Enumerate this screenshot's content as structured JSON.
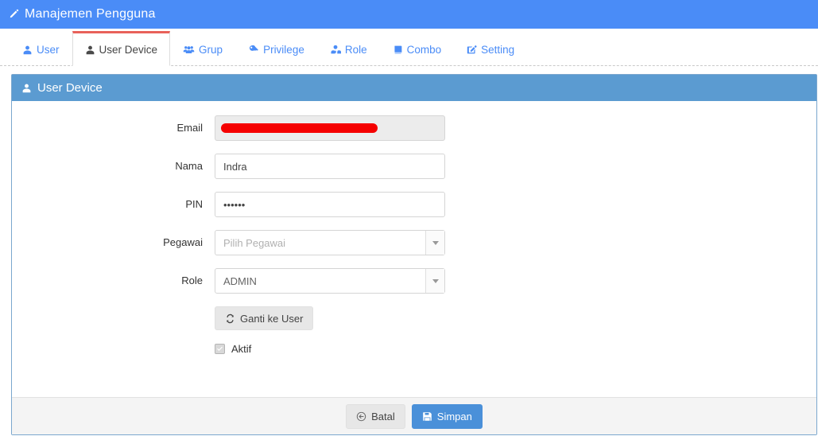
{
  "titlebar": {
    "icon": "pencil-icon",
    "title": "Manajemen Pengguna",
    "bg_color": "#4a8cf7"
  },
  "tabs": [
    {
      "label": "User",
      "icon": "user-icon",
      "active": false
    },
    {
      "label": "User Device",
      "icon": "user-icon",
      "active": true
    },
    {
      "label": "Grup",
      "icon": "users-group-icon",
      "active": false
    },
    {
      "label": "Privilege",
      "icon": "key-icon",
      "active": false
    },
    {
      "label": "Role",
      "icon": "user-shield-icon",
      "active": false
    },
    {
      "label": "Combo",
      "icon": "book-icon",
      "active": false
    },
    {
      "label": "Setting",
      "icon": "edit-square-icon",
      "active": false
    }
  ],
  "panel": {
    "header_icon": "user-icon",
    "header_title": "User Device",
    "header_bg": "#5b9bd1",
    "border_color": "#7ba7ce"
  },
  "form": {
    "email": {
      "label": "Email",
      "value": "",
      "redacted": true,
      "disabled": true
    },
    "nama": {
      "label": "Nama",
      "value": "Indra",
      "placeholder": ""
    },
    "pin": {
      "label": "PIN",
      "value": "••••••",
      "masked_length": 6
    },
    "pegawai": {
      "label": "Pegawai",
      "selected": "",
      "placeholder": "Pilih Pegawai"
    },
    "role": {
      "label": "Role",
      "selected": "ADMIN",
      "placeholder": ""
    },
    "switch_button": {
      "label": "Ganti ke User",
      "icon": "refresh-icon"
    },
    "aktif": {
      "label": "Aktif",
      "checked": true
    }
  },
  "footer": {
    "cancel": {
      "label": "Batal",
      "icon": "back-circle-icon"
    },
    "save": {
      "label": "Simpan",
      "icon": "floppy-save-icon",
      "color": "#4a90d9"
    }
  }
}
